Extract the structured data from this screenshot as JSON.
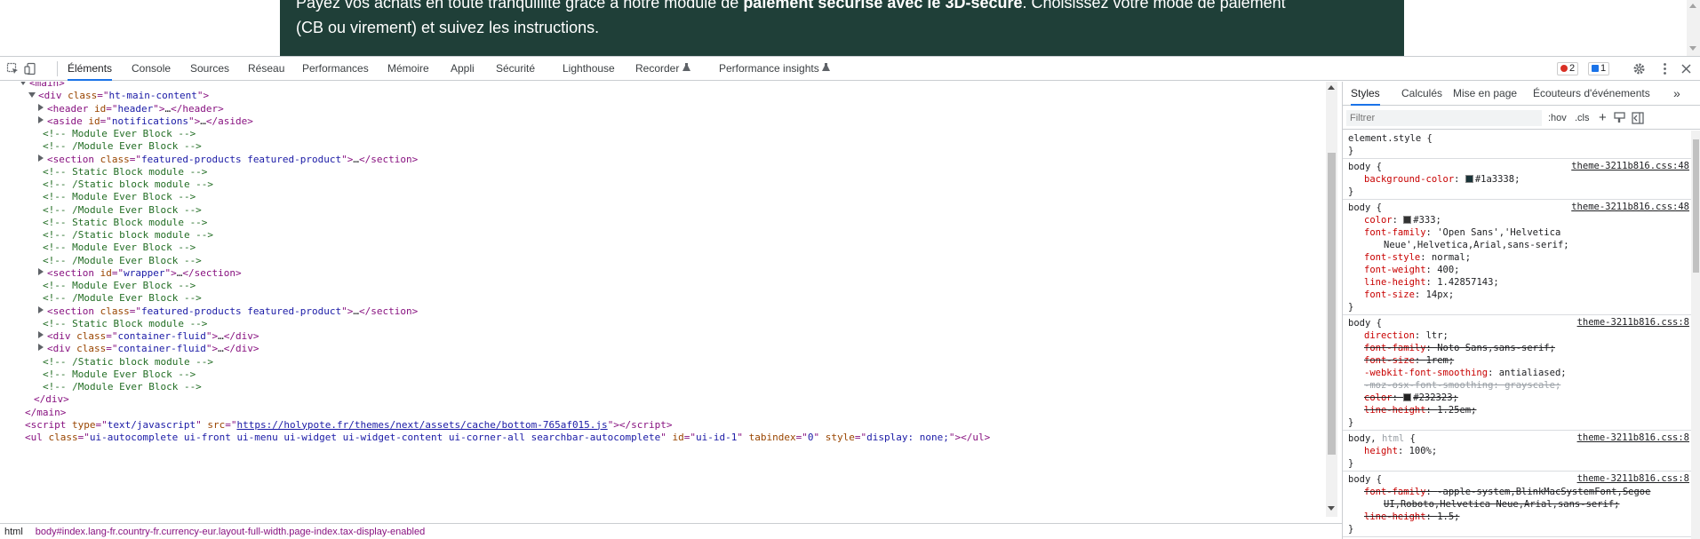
{
  "page": {
    "banner_line1_pre": "Payez vos achats en toute tranquillité grâce à notre module de ",
    "banner_line1_bold": "paiement sécurisé avec le 3D-secure",
    "banner_line1_post": ". Choisissez votre mode de paiement",
    "banner_line2": "(CB ou virement) et suivez les instructions.",
    "banner_color": "#1f3f38"
  },
  "devtools": {
    "tabs": [
      "Éléments",
      "Console",
      "Sources",
      "Réseau",
      "Performances",
      "Mémoire",
      "Appli",
      "Sécurité",
      "Lighthouse",
      "Recorder",
      "Performance insights"
    ],
    "errors_count": "2",
    "messages_count": "1",
    "icons": {
      "inspect": "inspect-icon",
      "device": "device-toolbar-icon",
      "settings": "gear-icon",
      "more": "kebab-menu-icon",
      "close": "close-icon"
    }
  },
  "elements": {
    "lines": [
      {
        "t": "tag",
        "text": "<main>"
      },
      {
        "t": "open",
        "tag": "div",
        "attr": "class",
        "val": "ht-main-content"
      },
      {
        "t": "closed",
        "tag": "header",
        "attr": "id",
        "val": "header",
        "end": "header"
      },
      {
        "t": "closed",
        "tag": "aside",
        "attr": "id",
        "val": "notifications",
        "end": "aside"
      },
      {
        "t": "comment",
        "text": "<!-- Module Ever Block -->"
      },
      {
        "t": "comment",
        "text": "<!-- /Module Ever Block -->"
      },
      {
        "t": "closed",
        "tag": "section",
        "attr": "class",
        "val": "featured-products featured-product",
        "end": "section"
      },
      {
        "t": "comment",
        "text": "<!-- Static Block module -->"
      },
      {
        "t": "comment",
        "text": "<!-- /Static block module -->"
      },
      {
        "t": "comment",
        "text": "<!-- Module Ever Block -->"
      },
      {
        "t": "comment",
        "text": "<!-- /Module Ever Block -->"
      },
      {
        "t": "comment",
        "text": "<!-- Static Block module -->"
      },
      {
        "t": "comment",
        "text": "<!-- /Static block module -->"
      },
      {
        "t": "comment",
        "text": "<!-- Module Ever Block -->"
      },
      {
        "t": "comment",
        "text": "<!-- /Module Ever Block -->"
      },
      {
        "t": "closed",
        "tag": "section",
        "attr": "id",
        "val": "wrapper",
        "end": "section"
      },
      {
        "t": "comment",
        "text": "<!-- Module Ever Block -->"
      },
      {
        "t": "comment",
        "text": "<!-- /Module Ever Block -->"
      },
      {
        "t": "closed",
        "tag": "section",
        "attr": "class",
        "val": "featured-products featured-product",
        "end": "section"
      },
      {
        "t": "comment",
        "text": "<!-- Static Block module -->"
      },
      {
        "t": "closed",
        "tag": "div",
        "attr": "class",
        "val": "container-fluid",
        "end": "div"
      },
      {
        "t": "closed",
        "tag": "div",
        "attr": "class",
        "val": "container-fluid",
        "end": "div"
      },
      {
        "t": "comment",
        "text": "<!-- /Static block module -->"
      },
      {
        "t": "comment",
        "text": "<!-- Module Ever Block -->"
      },
      {
        "t": "comment",
        "text": "<!-- /Module Ever Block -->"
      },
      {
        "t": "tag",
        "text": "</div>"
      },
      {
        "t": "tag",
        "text": "</main>"
      },
      {
        "t": "script",
        "src": "https://holypote.fr/themes/next/assets/cache/bottom-765af015.js"
      },
      {
        "t": "ul",
        "cls": "ui-autocomplete ui-front ui-menu ui-widget ui-widget-content ui-corner-all searchbar-autocomplete",
        "id": "ui-id-1",
        "tabindex": "0",
        "style": "display: none;"
      }
    ]
  },
  "breadcrumb": {
    "html": "html",
    "body": "body#index.lang-fr.country-fr.currency-eur.layout-full-width.page-index.tax-display-enabled"
  },
  "styles": {
    "subtabs": [
      "Styles",
      "Calculés",
      "Mise en page",
      "Écouteurs d'événements"
    ],
    "more": "»",
    "filter_placeholder": "Filtrer",
    "hov": ":hov",
    "cls": ".cls",
    "plus": "+",
    "rules": [
      {
        "sel": "element.style {",
        "src": "",
        "decls": []
      },
      {
        "sel": "body {",
        "src": "theme-3211b816.css:48",
        "decls": [
          {
            "n": "background-color",
            "v": "#1a3338;",
            "sw": "#1a3338"
          }
        ]
      },
      {
        "sel": "body {",
        "src": "theme-3211b816.css:48",
        "decls": [
          {
            "n": "color",
            "v": "#333;",
            "sw": "#333333"
          },
          {
            "n": "font-family",
            "v": "'Open Sans','Helvetica"
          },
          {
            "cont": "Neue',Helvetica,Arial,sans-serif;"
          },
          {
            "n": "font-style",
            "v": "normal;"
          },
          {
            "n": "font-weight",
            "v": "400;"
          },
          {
            "n": "line-height",
            "v": "1.42857143;"
          },
          {
            "n": "font-size",
            "v": "14px;"
          }
        ]
      },
      {
        "sel": "body {",
        "src": "theme-3211b816.css:8",
        "decls": [
          {
            "n": "direction",
            "v": "ltr;"
          },
          {
            "n": "font-family",
            "v": "Noto Sans,sans-serif;",
            "struck": true
          },
          {
            "n": "font-size",
            "v": "1rem;",
            "struck": true
          },
          {
            "n": "-webkit-font-smoothing",
            "v": "antialiased;"
          },
          {
            "n": "-moz-osx-font-smoothing",
            "v": "grayscale;",
            "struck": true,
            "dim": true
          },
          {
            "n": "color",
            "v": "#232323;",
            "struck": true,
            "sw": "#232323"
          },
          {
            "n": "line-height",
            "v": "1.25em;",
            "struck": true
          }
        ]
      },
      {
        "sel": "body, html {",
        "sel_dim": "html",
        "src": "theme-3211b816.css:8",
        "decls": [
          {
            "n": "height",
            "v": "100%;"
          }
        ]
      },
      {
        "sel": "body {",
        "src": "theme-3211b816.css:8",
        "decls": [
          {
            "n": "font-family",
            "v": "-apple-system,BlinkMacSystemFont,Segoe",
            "struck": true
          },
          {
            "cont": "UI,Roboto,Helvetica Neue,Arial,sans-serif;",
            "struck": true
          },
          {
            "n": "line-height",
            "v": "1.5;",
            "struck": true
          }
        ]
      }
    ]
  }
}
